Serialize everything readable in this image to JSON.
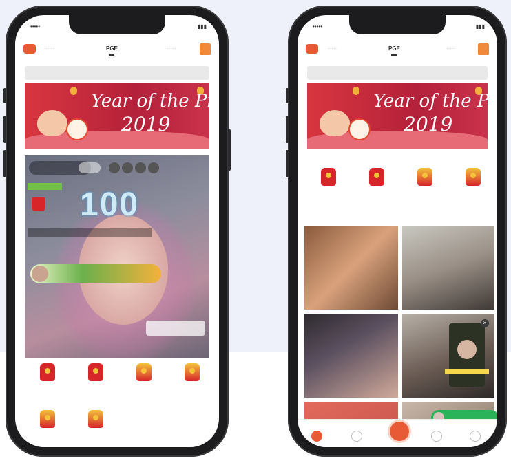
{
  "phone_left": {
    "tabs": [
      "PGE"
    ],
    "banner": {
      "title": "Year of the Pig",
      "year": "2019"
    },
    "live_combo": "100"
  },
  "phone_right": {
    "tabs": [
      "PGE"
    ],
    "banner": {
      "title": "Year of the Pig",
      "year": "2019"
    }
  },
  "colors": {
    "accent": "#e85a35",
    "banner_red": "#c62a3c",
    "green": "#2bb35a",
    "background": "#eef1fa"
  }
}
